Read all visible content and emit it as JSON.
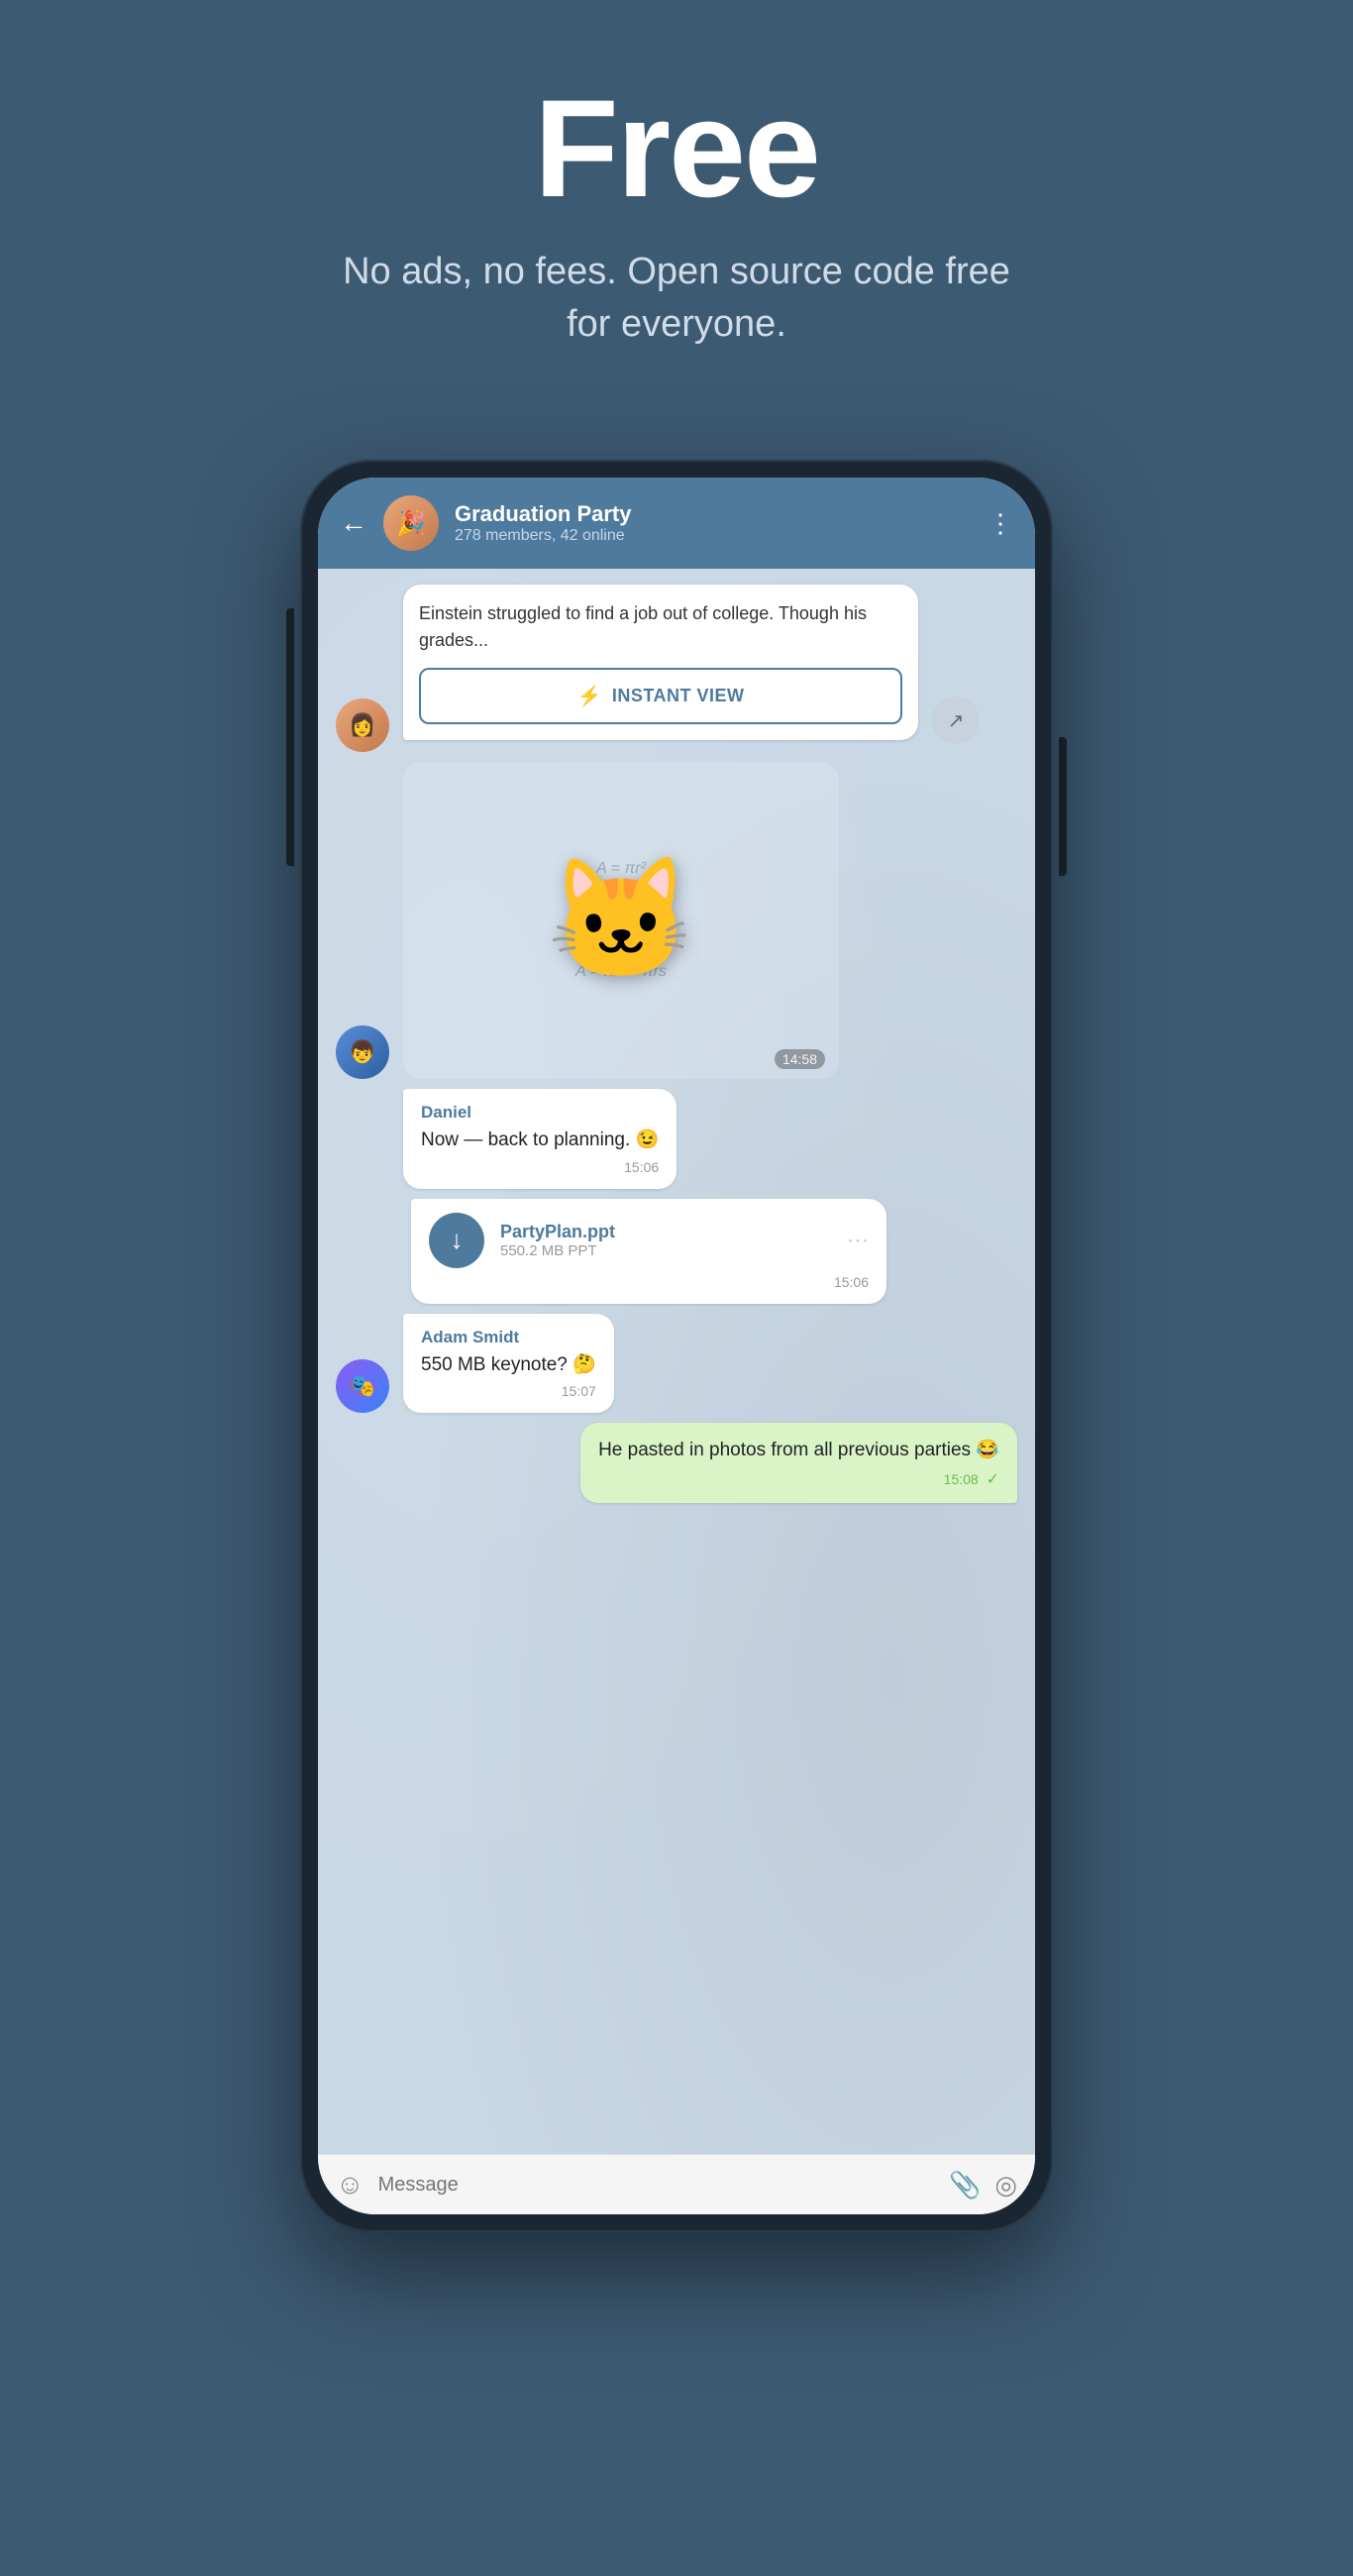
{
  "hero": {
    "title": "Free",
    "subtitle": "No ads, no fees. Open source code free for everyone."
  },
  "header": {
    "group_name": "Graduation Party",
    "members_info": "278 members, 42 online",
    "back_label": "←",
    "more_label": "⋮"
  },
  "article": {
    "text": "Einstein struggled to find a job out of college. Though his grades...",
    "instant_view_label": "INSTANT VIEW",
    "bolt_icon": "⚡"
  },
  "sticker": {
    "time": "14:58"
  },
  "messages": [
    {
      "id": "daniel_msg",
      "sender": "Daniel",
      "text": "Now — back to planning. 😉",
      "time": "15:06",
      "type": "incoming"
    },
    {
      "id": "file_msg",
      "filename": "PartyPlan.ppt",
      "filesize": "550.2 MB PPT",
      "time": "15:06",
      "type": "file"
    },
    {
      "id": "adam_msg",
      "sender": "Adam Smidt",
      "text": "550 MB keynote? 🤔",
      "time": "15:07",
      "type": "incoming"
    },
    {
      "id": "outgoing_msg",
      "text": "He pasted in photos from all previous parties 😂",
      "time": "15:08",
      "type": "outgoing"
    }
  ],
  "input_bar": {
    "placeholder": "Message"
  },
  "icons": {
    "emoji": "☺",
    "attach": "📎",
    "camera": "◎",
    "download": "↓",
    "share": "↗"
  }
}
